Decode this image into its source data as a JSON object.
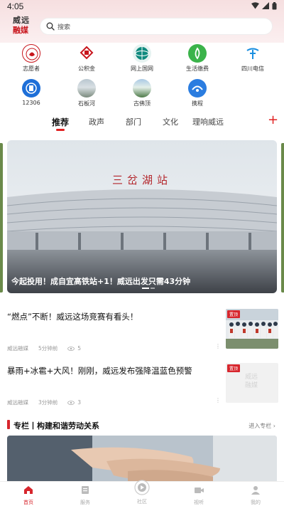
{
  "status_bar": {
    "time": "4:05"
  },
  "header": {
    "logo_line1": "威远",
    "logo_line2": "融媒",
    "search_placeholder": "搜索"
  },
  "quick_links": [
    {
      "label": "志愿者",
      "icon": "volunteer-logo"
    },
    {
      "label": "公积金",
      "icon": "housing-fund-logo"
    },
    {
      "label": "网上国网",
      "icon": "state-grid-logo"
    },
    {
      "label": "生活缴费",
      "icon": "bill-payment-logo"
    },
    {
      "label": "四川电信",
      "icon": "telecom-logo"
    },
    {
      "label": "12306",
      "icon": "railway-logo"
    },
    {
      "label": "石板河",
      "icon": "scenic-photo"
    },
    {
      "label": "古佛顶",
      "icon": "mountain-photo"
    },
    {
      "label": "携程",
      "icon": "ctrip-logo"
    }
  ],
  "tabs": [
    "推荐",
    "政声",
    "部门",
    "文化",
    "理响威远"
  ],
  "banner": {
    "sign_text": "三岔湖站",
    "caption": "今起投用！成自宜高铁站+1！威远出发只需43分钟"
  },
  "news": [
    {
      "title": "“燃点”不断！威远这场竞赛有看头！",
      "source": "威远融媒",
      "time": "5分钟前",
      "views": "5",
      "tag": "置顶"
    },
    {
      "title": "暴雨+冰雹+大风！刚刚，威远发布强降温蓝色预警",
      "source": "威远融媒",
      "time": "3分钟前",
      "views": "3",
      "tag": "置顶",
      "placeholder_text": "威远融媒"
    }
  ],
  "column": {
    "title": "专栏丨构建和谐劳动关系",
    "more": "进入专栏"
  },
  "bottom_nav": [
    {
      "label": "首页",
      "icon": "home-icon"
    },
    {
      "label": "服务",
      "icon": "service-icon"
    },
    {
      "label": "社区",
      "icon": "community-icon"
    },
    {
      "label": "视听",
      "icon": "video-icon"
    },
    {
      "label": "我的",
      "icon": "profile-icon"
    }
  ],
  "colors": {
    "accent": "#d7262d",
    "header_bg": "#f6dfe0"
  }
}
